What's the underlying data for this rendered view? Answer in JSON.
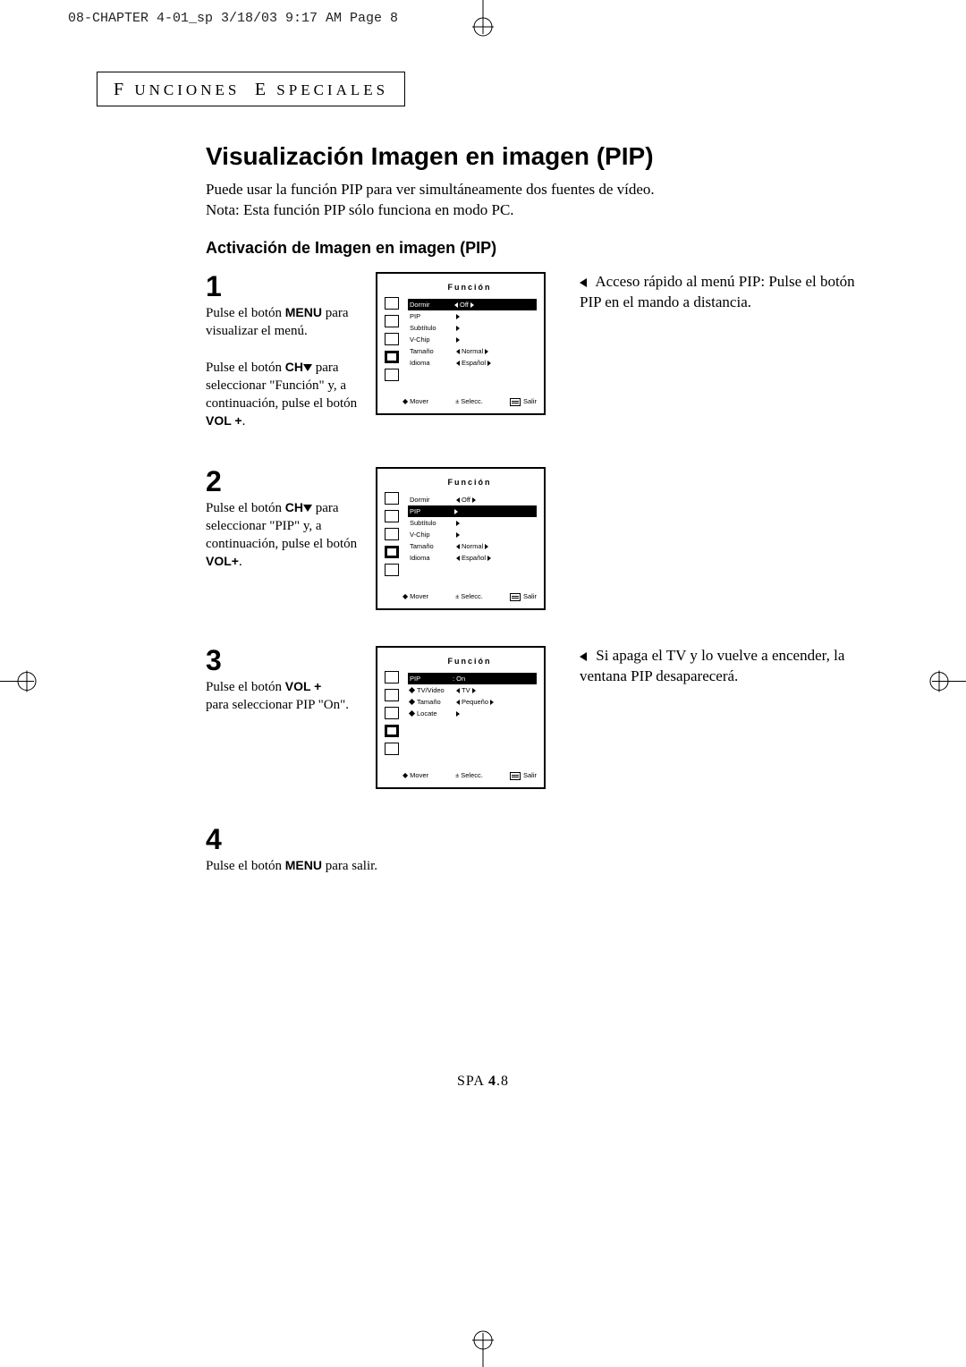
{
  "slug": "08-CHAPTER 4-01_sp  3/18/03 9:17 AM  Page 8",
  "section_tag": "FUNCIONES ESPECIALES",
  "title": "Visualización Imagen en imagen (PIP)",
  "intro_line1": "Puede usar la función PIP para ver simultáneamente dos fuentes de vídeo.",
  "intro_line2": "Nota: Esta función PIP sólo funciona en modo PC.",
  "subheading": "Activación de Imagen en imagen (PIP)",
  "steps": {
    "s1": {
      "num": "1",
      "l1a": "Pulse el botón ",
      "l1b": "MENU",
      "l2": "para visualizar el menú.",
      "l3a": "Pulse el botón ",
      "l3b": "CH",
      "l3c": " para seleccionar \"Función\" y, a continuación, pulse el botón ",
      "l3d": "VOL +",
      "l3e": ".",
      "tip_arrow": "◀",
      "tip": "Acceso rápido al menú PIP: Pulse el botón PIP en el mando a distancia."
    },
    "s2": {
      "num": "2",
      "l1a": "Pulse el botón ",
      "l1b": "CH",
      "l1c": " para seleccionar \"PIP\" y, a continuación, pulse el botón ",
      "l1d": "VOL+",
      "l1e": "."
    },
    "s3": {
      "num": "3",
      "l1a": "Pulse el botón ",
      "l1b": "VOL +",
      "l2": "para seleccionar PIP \"On\".",
      "tip_arrow": "◀",
      "tip": "Si apaga el TV y lo vuelve a encender, la ventana PIP desaparecerá."
    },
    "s4": {
      "num": "4",
      "l1a": "Pulse el botón ",
      "l1b": "MENU",
      "l1c": " para salir."
    }
  },
  "osd": {
    "title": "Función",
    "foot_move": "Mover",
    "foot_sel": "Selecc.",
    "foot_exit": "Salir",
    "menu1": {
      "r1": {
        "lbl": "Dormir",
        "val": "Off",
        "hi": true
      },
      "r2": {
        "lbl": "PIP"
      },
      "r3": {
        "lbl": "Subtítulo"
      },
      "r4": {
        "lbl": "V-Chip"
      },
      "r5": {
        "lbl": "Tamaño",
        "val": "Normal"
      },
      "r6": {
        "lbl": "Idioma",
        "val": "Español"
      }
    },
    "menu2": {
      "r1": {
        "lbl": "Dormir",
        "val": "Off"
      },
      "r2": {
        "lbl": "PIP",
        "hi": true
      },
      "r3": {
        "lbl": "Subtítulo"
      },
      "r4": {
        "lbl": "V-Chip"
      },
      "r5": {
        "lbl": "Tamaño",
        "val": "Normal"
      },
      "r6": {
        "lbl": "Idioma",
        "val": "Español"
      }
    },
    "menu3": {
      "r1": {
        "lbl": "PIP",
        "val": ": On",
        "hi": true
      },
      "r2": {
        "lbl": "TV/Video",
        "val": "TV",
        "dia": true
      },
      "r3": {
        "lbl": "Tamaño",
        "val": "Pequeño",
        "dia": true
      },
      "r4": {
        "lbl": "Locate",
        "dia": true
      }
    }
  },
  "page_footer": {
    "pre": "SPA ",
    "bold": "4",
    "post": ".8"
  }
}
